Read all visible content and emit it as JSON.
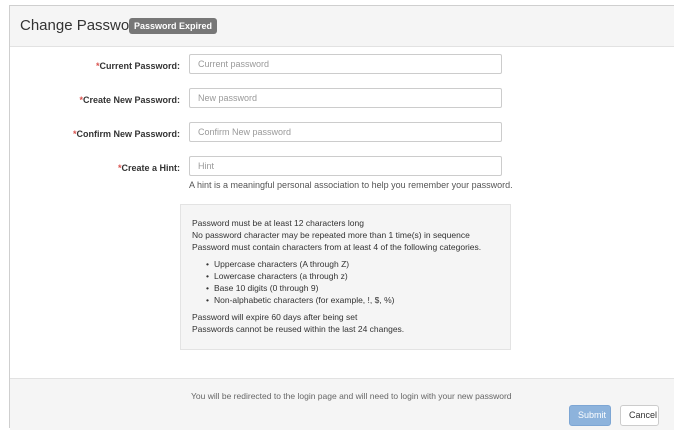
{
  "header": {
    "title": "Change Password",
    "badge": "Password Expired"
  },
  "form": {
    "required_marker": "*",
    "current_password": {
      "label": "Current Password:",
      "placeholder": "Current password"
    },
    "new_password": {
      "label": "Create New Password:",
      "placeholder": "New password"
    },
    "confirm_password": {
      "label": "Confirm New Password:",
      "placeholder": "Confirm New password"
    },
    "hint": {
      "label": "Create a Hint:",
      "placeholder": "Hint"
    },
    "hint_help": "A hint is a meaningful personal association to help you remember your password."
  },
  "rules": {
    "lines": [
      "Password must be at least 12 characters long",
      "No password character may be repeated more than 1 time(s) in sequence",
      "Password must contain characters from at least 4 of the following categories."
    ],
    "categories": [
      "Uppercase characters (A through Z)",
      "Lowercase characters (a through z)",
      "Base 10 digits (0 through 9)",
      "Non-alphabetic characters (for example, !, $, %)"
    ],
    "expiry_lines": [
      "Password will expire 60 days after being set",
      "Passwords cannot be reused within the last 24 changes."
    ]
  },
  "footer": {
    "redirect_note": "You will be redirected to the login page and will need to login with your new password",
    "submit_label": "Submit",
    "cancel_label": "Cancel"
  },
  "colors": {
    "badge_bg": "#777777",
    "required": "#d9534f",
    "submit_bg": "#8db3dc"
  }
}
